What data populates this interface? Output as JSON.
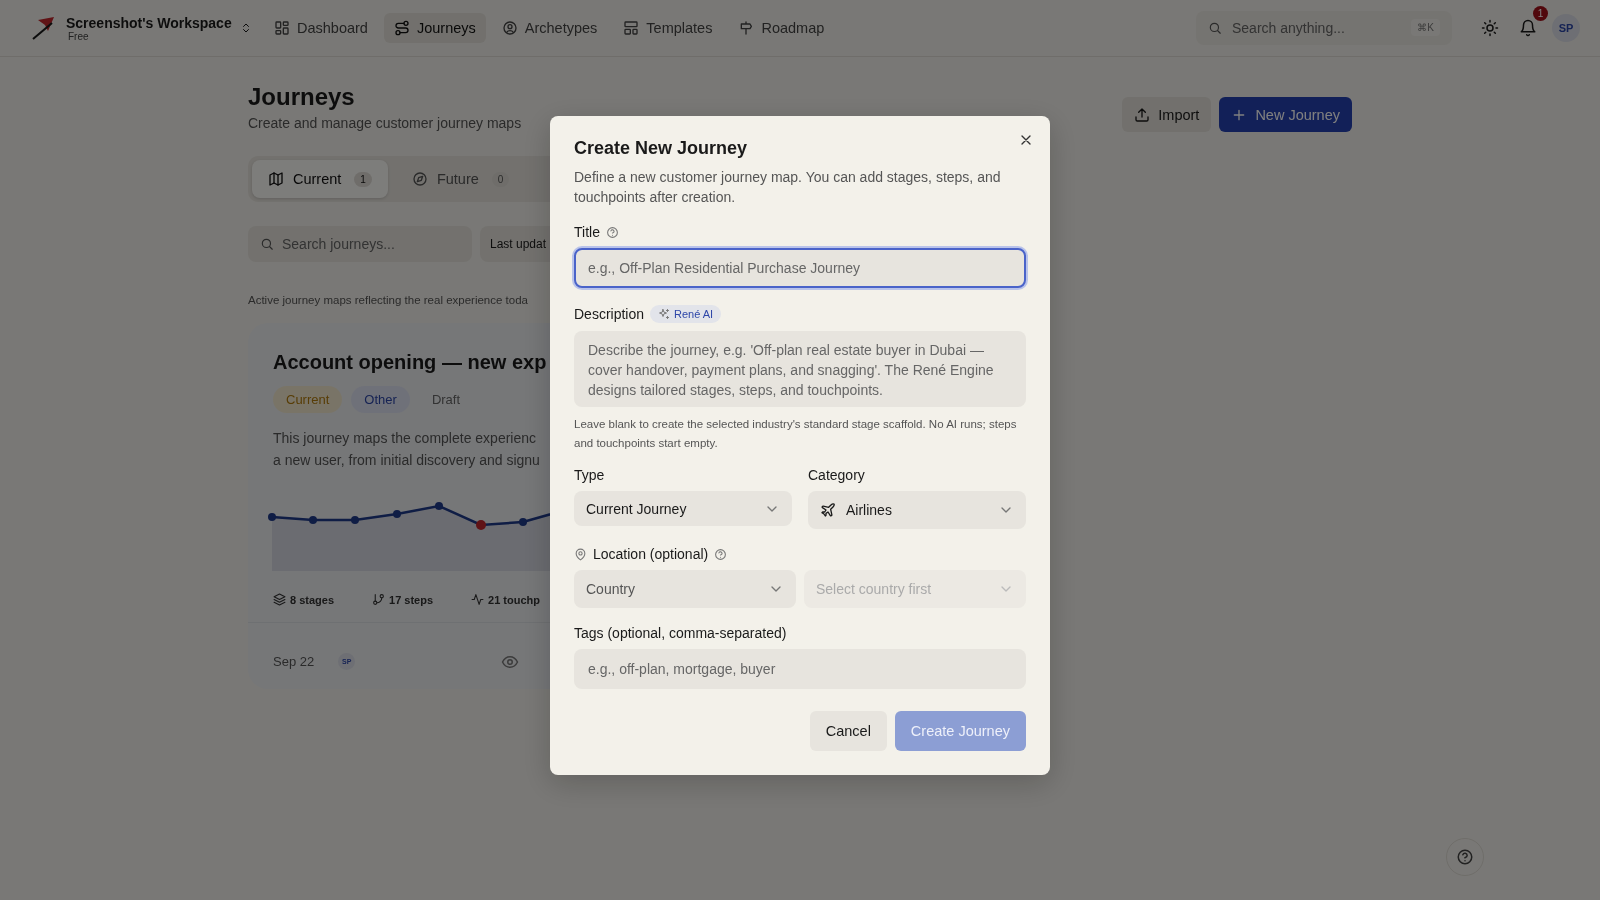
{
  "workspace": {
    "name": "Screenshot's Workspace",
    "plan": "Free"
  },
  "nav": [
    {
      "label": "Dashboard",
      "selected": false
    },
    {
      "label": "Journeys",
      "selected": true
    },
    {
      "label": "Archetypes",
      "selected": false
    },
    {
      "label": "Templates",
      "selected": false
    },
    {
      "label": "Roadmap",
      "selected": false
    }
  ],
  "search": {
    "placeholder": "Search anything...",
    "shortcut": "⌘K"
  },
  "notifications": {
    "count": "1"
  },
  "user": {
    "initials": "SP"
  },
  "page": {
    "title": "Journeys",
    "subtitle": "Create and manage customer journey maps",
    "import_button": "Import",
    "new_button": "New Journey"
  },
  "view_tabs": [
    {
      "label": "Current",
      "count": "1",
      "selected": true
    },
    {
      "label": "Future",
      "count": "0",
      "selected": false
    }
  ],
  "journey_search": {
    "placeholder": "Search journeys..."
  },
  "sort": {
    "value": "Last updat"
  },
  "section_note": "Active journey maps reflecting the real experience toda",
  "card": {
    "title": "Account opening — new exp",
    "tags": [
      {
        "label": "Current",
        "kind": "status"
      },
      {
        "label": "Other",
        "kind": "category"
      },
      {
        "label": "Draft",
        "kind": "stage"
      }
    ],
    "description_lines": [
      "This journey maps the complete experienc",
      "a new user, from initial discovery and signu"
    ],
    "stats": [
      "8 stages",
      "17 steps",
      "21 touchp"
    ],
    "date": "Sep 22",
    "owner": "SP"
  },
  "dialog": {
    "title": "Create New Journey",
    "description": "Define a new customer journey map. You can add stages, steps, and touchpoints after creation.",
    "title_label": "Title",
    "title_placeholder": "e.g., Off-Plan Residential Purchase Journey",
    "title_focused": true,
    "description_label": "Description",
    "ai_badge": "René AI",
    "description_placeholder": "Describe the journey, e.g. 'Off-plan real estate buyer in Dubai — cover handover, payment plans, and snagging'. The René Engine designs tailored stages, steps, and touchpoints.",
    "hint": "Leave blank to create the selected industry's standard stage scaffold. No AI runs; steps and touchpoints start empty.",
    "type_label": "Type",
    "type_value": "Current Journey",
    "category_label": "Category",
    "category_value": "Airlines",
    "location_label": "Location (optional)",
    "country_placeholder": "Country",
    "city_placeholder": "Select country first",
    "city_disabled": true,
    "tags_label": "Tags (optional, comma-separated)",
    "tags_placeholder": "e.g., off-plan, mortgage, buyer",
    "cancel_button": "Cancel",
    "create_button": "Create Journey",
    "create_disabled": true
  }
}
